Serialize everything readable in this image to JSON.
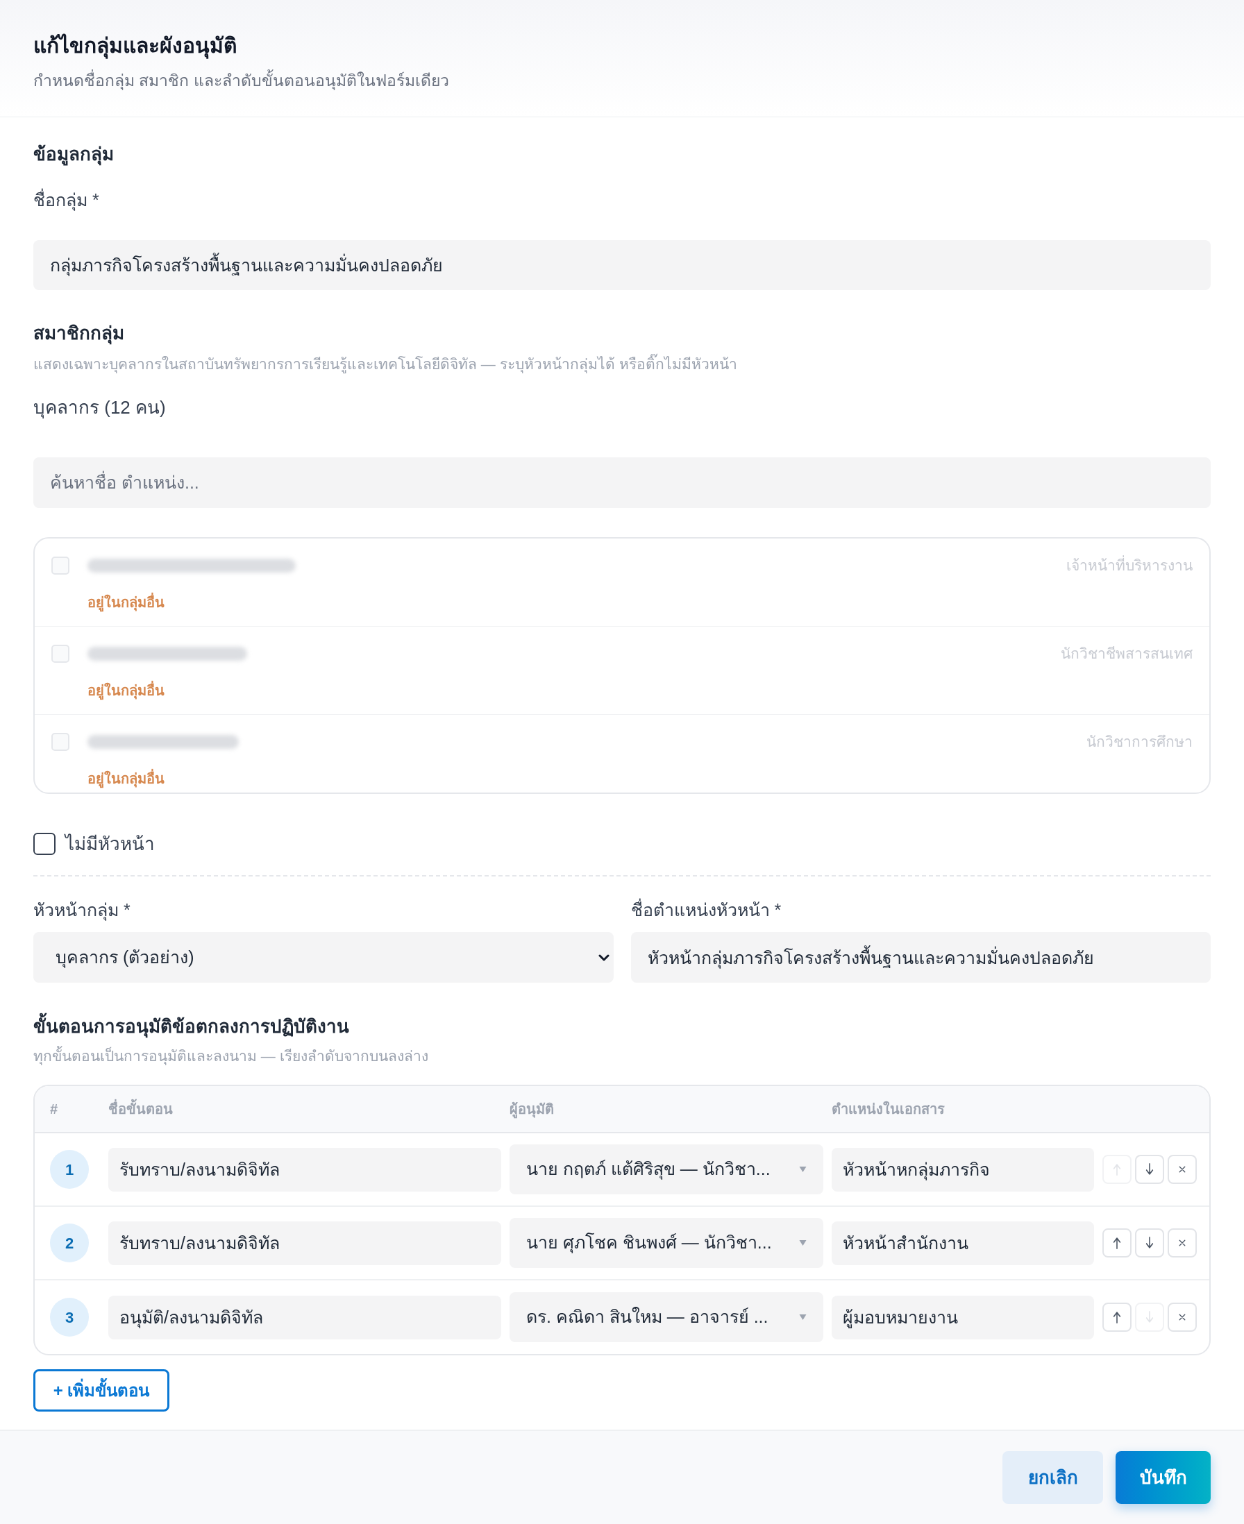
{
  "dialog": {
    "title": "แก้ไขกลุ่มและผังอนุมัติ",
    "subtitle": "กำหนดชื่อกลุ่ม สมาชิก และลำดับขั้นตอนอนุมัติในฟอร์มเดียว"
  },
  "group_info": {
    "heading": "ข้อมูลกลุ่ม",
    "name_label": "ชื่อกลุ่ม *",
    "name_value": "กลุ่มภารกิจโครงสร้างพื้นฐานและความมั่นคงปลอดภัย"
  },
  "members": {
    "heading": "สมาชิกกลุ่ม",
    "description": "แสดงเฉพาะบุคลากรในสถาบันทรัพยากรการเรียนรู้และเทคโนโลยีดิจิทัล — ระบุหัวหน้ากลุ่มได้ หรือติ๊กไม่มีหัวหน้า",
    "count_label": "บุคลากร (12 คน)",
    "search": {
      "placeholder": "ค้นหาชื่อ ตำแหน่ง..."
    },
    "items": [
      {
        "role": "เจ้าหน้าที่บริหารงาน",
        "tag": "อยู่ในกลุ่มอื่น",
        "checked": false,
        "disabled": true
      },
      {
        "role": "นักวิชาชีพสารสนเทศ",
        "tag": "อยู่ในกลุ่มอื่น",
        "checked": false,
        "disabled": true
      },
      {
        "role": "นักวิชาการศึกษา",
        "tag": "อยู่ในกลุ่มอื่น",
        "checked": false,
        "disabled": true
      }
    ]
  },
  "no_head": {
    "label": "ไม่มีหัวหน้า",
    "checked": false
  },
  "head": {
    "head_label": "หัวหน้ากลุ่ม *",
    "head_value": "บุคลากร (ตัวอย่าง)",
    "title_label": "ชื่อตำแหน่งหัวหน้า *",
    "title_value": "หัวหน้ากลุ่มภารกิจโครงสร้างพื้นฐานและความมั่นคงปลอดภัย"
  },
  "approval": {
    "heading": "ขั้นตอนการอนุมัติข้อตกลงการปฏิบัติงาน",
    "description": "ทุกขั้นตอนเป็นการอนุมัติและลงนาม — เรียงลำดับจากบนลงล่าง",
    "columns": [
      "#",
      "ชื่อขั้นตอน",
      "ผู้อนุมัติ",
      "ตำแหน่งในเอกสาร"
    ],
    "steps": [
      {
        "number": "1",
        "name": "รับทราบ/ลงนามดิจิทัล",
        "approver": "นาย กฤตภ์ แต้ศิริสุข — นักวิชา...",
        "position": "หัวหน้าหกลุ่มภารกิจ",
        "up_disabled": true,
        "down_disabled": false
      },
      {
        "number": "2",
        "name": "รับทราบ/ลงนามดิจิทัล",
        "approver": "นาย ศุภโชค ชินพงศ์ — นักวิชา...",
        "position": "หัวหน้าสำนักงาน",
        "up_disabled": false,
        "down_disabled": false
      },
      {
        "number": "3",
        "name": "อนุมัติ/ลงนามดิจิทัล",
        "approver": "ดร. คณิดา สินใหม — อาจารย์ ...",
        "position": "ผู้มอบหมายงาน",
        "up_disabled": false,
        "down_disabled": true
      }
    ],
    "add_button": "+ เพิ่มขั้นตอน"
  },
  "footer": {
    "buttons": [
      {
        "label": "ยกเลิก",
        "kind": "secondary"
      },
      {
        "label": "บันทึก",
        "kind": "primary"
      }
    ]
  }
}
